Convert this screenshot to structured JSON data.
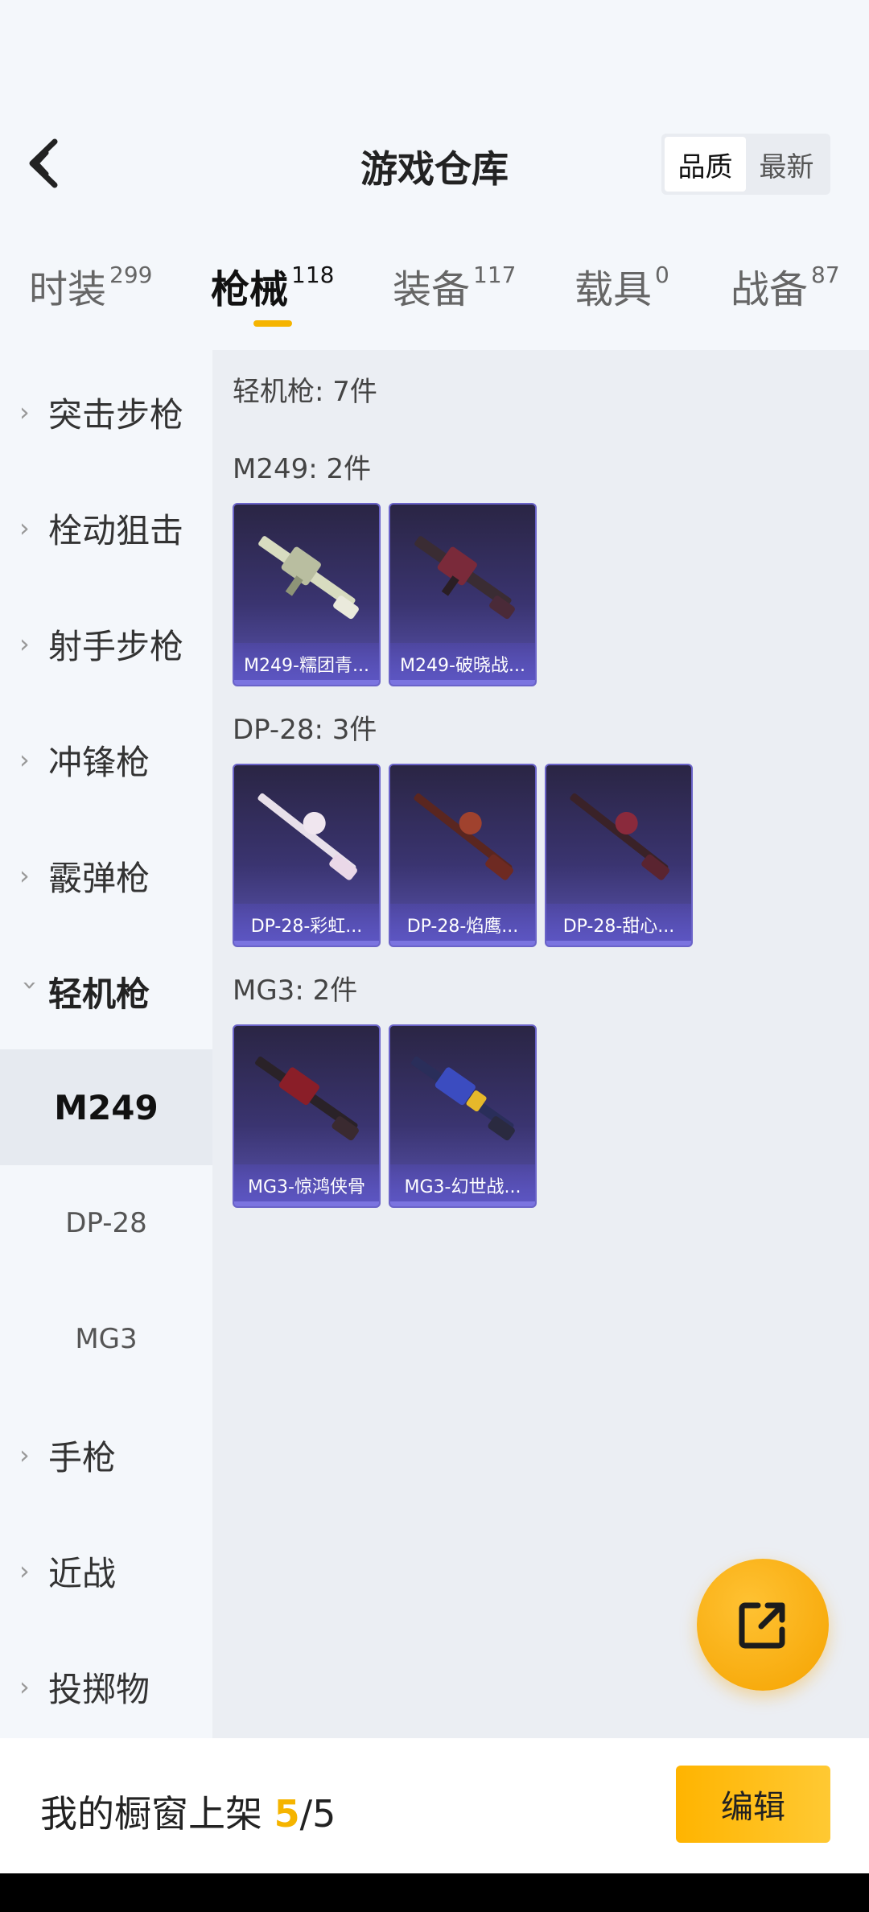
{
  "header": {
    "title": "游戏仓库",
    "sort_options": [
      "品质",
      "最新"
    ],
    "sort_active": "品质"
  },
  "tabs": [
    {
      "label": "时装",
      "count": "299"
    },
    {
      "label": "枪械",
      "count": "118"
    },
    {
      "label": "装备",
      "count": "117"
    },
    {
      "label": "载具",
      "count": "0"
    },
    {
      "label": "战备",
      "count": "87"
    }
  ],
  "sidebar": {
    "categories": [
      "突击步枪",
      "栓动狙击",
      "射手步枪",
      "冲锋枪",
      "霰弹枪",
      "轻机枪"
    ],
    "sub_items": [
      "M249",
      "DP-28",
      "MG3"
    ],
    "more_categories": [
      "手枪",
      "近战",
      "投掷物"
    ]
  },
  "content": {
    "summary": "轻机枪: 7件",
    "groups": [
      {
        "title": "M249: 2件",
        "items": [
          "M249-糯团青...",
          "M249-破晓战..."
        ]
      },
      {
        "title": "DP-28: 3件",
        "items": [
          "DP-28-彩虹...",
          "DP-28-焰鹰...",
          "DP-28-甜心..."
        ]
      },
      {
        "title": "MG3: 2件",
        "items": [
          "MG3-惊鸿侠骨",
          "MG3-幻世战..."
        ]
      }
    ]
  },
  "bottom": {
    "label": "我的橱窗上架 ",
    "current": "5",
    "total": "/5",
    "edit_label": "编辑"
  },
  "colors": {
    "accent": "#f5b400",
    "card": "#3a3470"
  },
  "icons": {
    "back": "chevron-left-icon",
    "share": "share-external-icon"
  }
}
